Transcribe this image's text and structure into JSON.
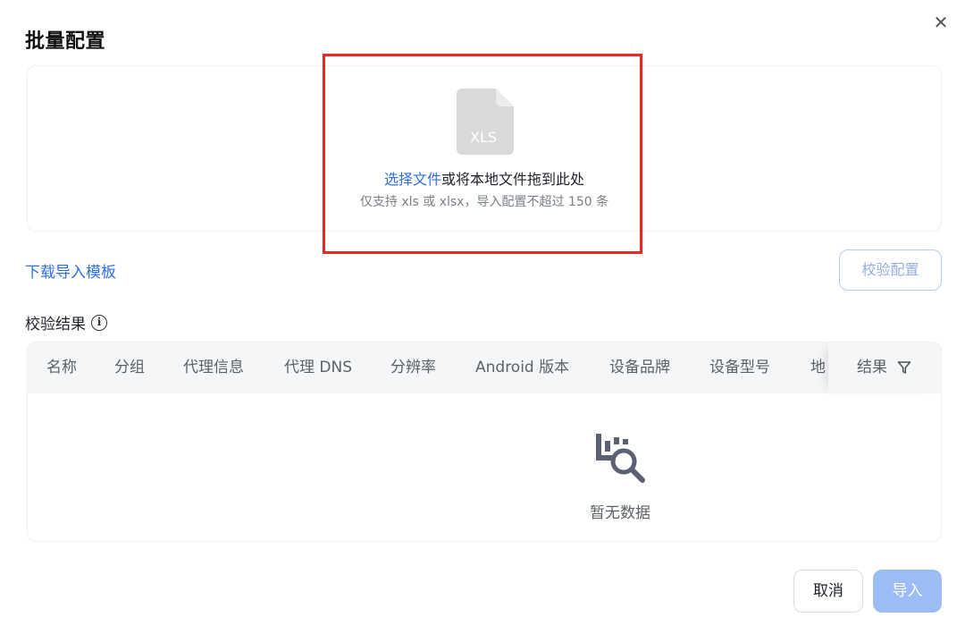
{
  "dialog": {
    "title": "批量配置",
    "close_icon": "close-icon"
  },
  "upload": {
    "file_type_label": "XLS",
    "select_link": "选择文件",
    "drag_text": "或将本地文件拖到此处",
    "hint": "仅支持 xls 或 xlsx，导入配置不超过 150 条",
    "highlight_color": "#e8251f"
  },
  "actions": {
    "download_template": "下载导入模板",
    "validate_button": "校验配置"
  },
  "results": {
    "label": "校验结果",
    "info_icon": "info-icon",
    "columns": [
      "名称",
      "分组",
      "代理信息",
      "代理 DNS",
      "分辨率",
      "Android 版本",
      "设备品牌",
      "设备型号",
      "地"
    ],
    "result_column": "结果",
    "filter_icon": "filter-icon",
    "empty_icon": "empty-data-icon",
    "empty_text": "暂无数据"
  },
  "footer": {
    "cancel": "取消",
    "import": "导入"
  },
  "colors": {
    "link": "#2f6fe4",
    "primary_disabled": "#9bbcf5",
    "header_bg": "#f5f6f8"
  }
}
